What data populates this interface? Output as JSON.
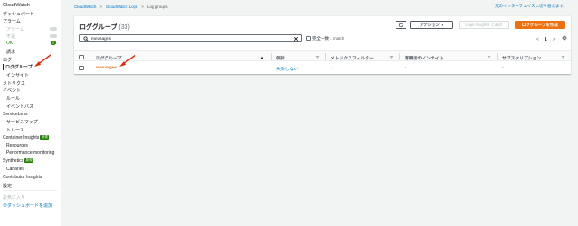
{
  "sidebar": {
    "items": [
      {
        "label": "CloudWatch"
      },
      {
        "label": "ダッシュボード"
      },
      {
        "label": "アラーム"
      },
      {
        "label": "アラーム"
      },
      {
        "label": "不足"
      },
      {
        "label": "OK"
      },
      {
        "label": "請求"
      },
      {
        "label": "ログ"
      },
      {
        "label": "ロググループ"
      },
      {
        "label": "インサイト"
      },
      {
        "label": "メトリクス"
      },
      {
        "label": "イベント"
      },
      {
        "label": "ルール"
      },
      {
        "label": "イベントバス"
      },
      {
        "label": "ServiceLens"
      },
      {
        "label": "サービスマップ"
      },
      {
        "label": "トレース"
      },
      {
        "label": "Container Insights"
      },
      {
        "label": "Resources"
      },
      {
        "label": "Performance monitoring"
      },
      {
        "label": "Synthetics"
      },
      {
        "label": "Canaries"
      },
      {
        "label": "Contributor Insights"
      },
      {
        "label": "設定"
      },
      {
        "label": "お気に入り"
      },
      {
        "label": "ダッシュボードを追加"
      }
    ],
    "ok_count": "0",
    "new_badge": "新規",
    "add_symbol": "⊕"
  },
  "breadcrumb": {
    "items": [
      "CloudWatch",
      "CloudWatch Logs",
      "Log groups"
    ],
    "separator": ">"
  },
  "switch_link": "元のインターフェイスに切り替えます。",
  "panel": {
    "title": "ロググループ",
    "count": "(33)",
    "refresh_icon": "refresh-icon",
    "actions_label": "アクション",
    "actions_caret": "▼",
    "insights_label": "Logs Insights で表示",
    "create_label": "ロググループを作成"
  },
  "search": {
    "value": "messages",
    "exact_label": "完全一致",
    "match_text": "1 match"
  },
  "pager": {
    "prev": "<",
    "page": "1",
    "next": ">",
    "settings_icon": "gear-icon"
  },
  "table": {
    "headers": [
      "ロググループ",
      "保持",
      "メトリクスフィルター",
      "寄稿者のインサイト",
      "サブスクリプション"
    ],
    "sort_icon": "▲",
    "rows": [
      {
        "name": "messages",
        "retention": "失効しない",
        "metric_filters": "-",
        "contributor_insights": "-",
        "subscription": "-"
      }
    ]
  },
  "colors": {
    "accent_orange": "#ec7211",
    "link_blue": "#0073bb",
    "annotation_red": "#d13212",
    "ok_green": "#1d8102"
  }
}
